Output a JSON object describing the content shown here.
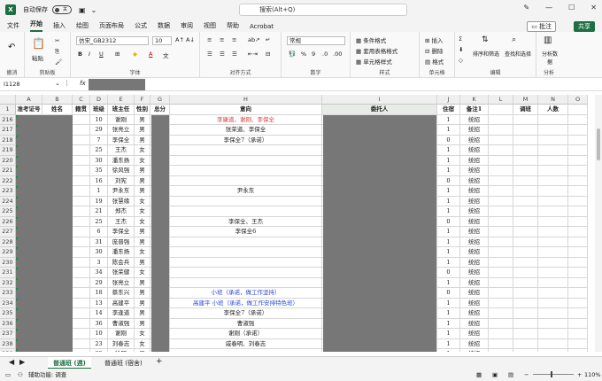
{
  "titlebar": {
    "autosave_label": "自动保存",
    "toggle_state": "关",
    "search_placeholder": "搜索(Alt+Q)"
  },
  "menu": {
    "items": [
      "文件",
      "开始",
      "插入",
      "绘图",
      "页面布局",
      "公式",
      "数据",
      "审阅",
      "视图",
      "帮助",
      "Acrobat"
    ],
    "active": "开始",
    "comment_label": "批注",
    "share_label": "共享"
  },
  "ribbon": {
    "undo_label": "撤消",
    "paste_label": "粘贴",
    "clipboard_label": "剪贴板",
    "font_name": "仿宋_GB2312",
    "font_size": "10",
    "font_label": "字体",
    "align_label": "对齐方式",
    "number_format": "常规",
    "number_label": "数字",
    "cond_format": "条件格式",
    "table_format": "套用表格格式",
    "cell_style": "单元格样式",
    "style_label": "样式",
    "insert_label": "插入",
    "delete_label": "删除",
    "format_label": "格式",
    "cells_label": "单元格",
    "sort_label": "排序和筛选",
    "find_label": "查找和选择",
    "edit_label": "编辑",
    "analyze_label": "分析数据",
    "analysis_label": "分析"
  },
  "formula": {
    "cell_ref": "I1128",
    "fx": "fx"
  },
  "columns": [
    "A",
    "B",
    "C",
    "D",
    "E",
    "F",
    "G",
    "H",
    "I",
    "J",
    "K",
    "L",
    "M",
    "N",
    "O"
  ],
  "header_row": {
    "row_num": "1",
    "a": "准考证号",
    "b": "姓名",
    "c": "籍贯",
    "d": "班级",
    "e": "班主任",
    "f": "性别",
    "g": "总分",
    "h": "意向",
    "i": "委托人",
    "j": "住宿",
    "k": "备注1",
    "m": "调班",
    "n": "人数"
  },
  "rows": [
    {
      "n": "216",
      "d": "10",
      "e": "谢刚",
      "f": "男",
      "h": "李康道、谢刚、李保全",
      "h_color": "#e03c3c",
      "j": "1",
      "k": "统招"
    },
    {
      "n": "217",
      "d": "29",
      "e": "张亮立",
      "f": "男",
      "h": "张荣道、李保全",
      "h_color": "#222",
      "j": "1",
      "k": "统招"
    },
    {
      "n": "218",
      "d": "7",
      "e": "李保全",
      "f": "男",
      "h": "李保全7（承诺）",
      "h_color": "#222",
      "j": "0",
      "k": "统招"
    },
    {
      "n": "219",
      "d": "25",
      "e": "王杰",
      "f": "女",
      "h": "",
      "h_color": "#222",
      "j": "1",
      "k": "统招"
    },
    {
      "n": "220",
      "d": "30",
      "e": "潘东扬",
      "f": "女",
      "h": "",
      "h_color": "#222",
      "j": "1",
      "k": "统招"
    },
    {
      "n": "221",
      "d": "35",
      "e": "徐风强",
      "f": "男",
      "h": "",
      "h_color": "#222",
      "j": "1",
      "k": "统招"
    },
    {
      "n": "222",
      "d": "16",
      "e": "刘宪",
      "f": "男",
      "h": "",
      "h_color": "#222",
      "j": "0",
      "k": "统招"
    },
    {
      "n": "223",
      "d": "1",
      "e": "尹永东",
      "f": "男",
      "h": "尹永东",
      "h_color": "#222",
      "j": "1",
      "k": "统招"
    },
    {
      "n": "224",
      "d": "19",
      "e": "张慧缘",
      "f": "女",
      "h": "",
      "h_color": "#222",
      "j": "1",
      "k": "统招"
    },
    {
      "n": "225",
      "d": "21",
      "e": "郑杰",
      "f": "女",
      "h": "",
      "h_color": "#222",
      "j": "1",
      "k": "统招"
    },
    {
      "n": "226",
      "d": "25",
      "e": "王杰",
      "f": "女",
      "h": "李保全、王杰",
      "h_color": "#222",
      "j": "0",
      "k": "统招"
    },
    {
      "n": "227",
      "d": "6",
      "e": "李保全",
      "f": "男",
      "h": "李保全6",
      "h_color": "#222",
      "j": "1",
      "k": "统招"
    },
    {
      "n": "228",
      "d": "31",
      "e": "庞晋强",
      "f": "男",
      "h": "",
      "h_color": "#222",
      "j": "1",
      "k": "统招"
    },
    {
      "n": "229",
      "d": "30",
      "e": "潘东扬",
      "f": "女",
      "h": "",
      "h_color": "#222",
      "j": "1",
      "k": "统招"
    },
    {
      "n": "230",
      "d": "3",
      "e": "陈会兵",
      "f": "男",
      "h": "",
      "h_color": "#222",
      "j": "1",
      "k": "统招"
    },
    {
      "n": "231",
      "d": "34",
      "e": "张荣健",
      "f": "女",
      "h": "",
      "h_color": "#222",
      "j": "0",
      "k": "统招"
    },
    {
      "n": "232",
      "d": "29",
      "e": "张亮立",
      "f": "男",
      "h": "",
      "h_color": "#222",
      "j": "1",
      "k": "统招"
    },
    {
      "n": "233",
      "d": "18",
      "e": "蔡东兴",
      "f": "男",
      "h": "小班（承诺，做工作坚持）",
      "h_color": "#2b49d8",
      "j": "0",
      "k": "统招"
    },
    {
      "n": "234",
      "d": "13",
      "e": "高建平",
      "f": "男",
      "h": "高建平 小班（承诺，做工作安排特色班）",
      "h_color": "#2b49d8",
      "j": "1",
      "k": "统招"
    },
    {
      "n": "235",
      "d": "14",
      "e": "李逢道",
      "f": "男",
      "h": "李保全7（承诺）",
      "h_color": "#222",
      "j": "1",
      "k": "统招"
    },
    {
      "n": "236",
      "d": "36",
      "e": "曹淑强",
      "f": "男",
      "h": "曹淑强",
      "h_color": "#222",
      "j": "1",
      "k": "统招"
    },
    {
      "n": "237",
      "d": "10",
      "e": "谢刚",
      "f": "女",
      "h": "谢刚（承诺）",
      "h_color": "#222",
      "j": "1",
      "k": "统招"
    },
    {
      "n": "238",
      "d": "23",
      "e": "刘春志",
      "f": "女",
      "h": "戚春明、刘春志",
      "h_color": "#222",
      "j": "1",
      "k": "统招"
    },
    {
      "n": "239",
      "d": "32",
      "e": "徐明",
      "f": "男",
      "h": "",
      "h_color": "#222",
      "j": "1",
      "k": "统招"
    }
  ],
  "sheets": [
    "普通班 (週)",
    "普通班 (宿舍)"
  ],
  "active_sheet": "普通班 (週)",
  "status": {
    "accessibility": "辅助功能: 调查",
    "zoom": "110%"
  }
}
